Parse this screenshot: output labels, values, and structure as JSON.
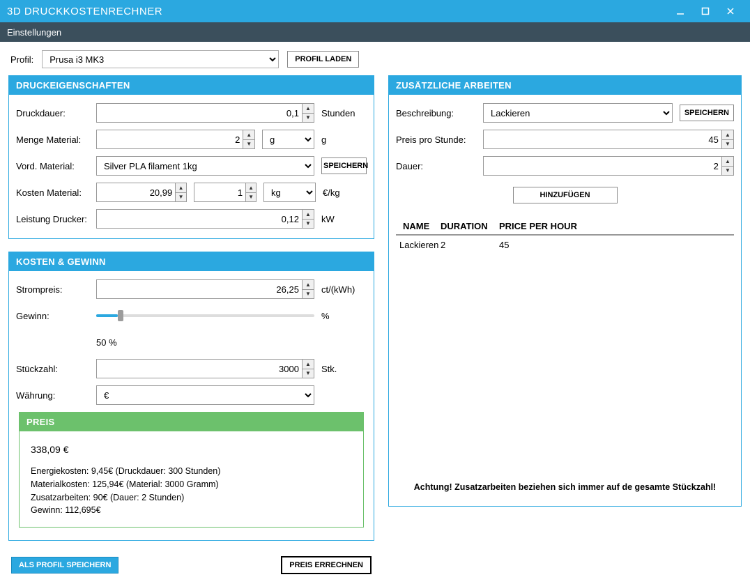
{
  "window": {
    "title": "3D DRUCKKOSTENRECHNER"
  },
  "menu": {
    "settings": "Einstellungen"
  },
  "profile": {
    "label": "Profil:",
    "selected": "Prusa i3 MK3",
    "load_btn": "PROFIL LADEN"
  },
  "props": {
    "header": "DRUCKEIGENSCHAFTEN",
    "duration_label": "Druckdauer:",
    "duration_value": "0,1",
    "duration_unit": "Stunden",
    "amount_label": "Menge Material:",
    "amount_value": "2",
    "amount_unit_sel": "g",
    "amount_unit": "g",
    "material_label": "Vord. Material:",
    "material_sel": "Silver PLA filament 1kg",
    "material_save": "SPEICHERN",
    "cost_label": "Kosten Material:",
    "cost_value": "20,99",
    "cost_qty": "1",
    "cost_unit_sel": "kg",
    "cost_unit": "€/kg",
    "power_label": "Leistung Drucker:",
    "power_value": "0,12",
    "power_unit": "kW"
  },
  "costs": {
    "header": "KOSTEN & GEWINN",
    "elec_label": "Strompreis:",
    "elec_value": "26,25",
    "elec_unit": "ct/(kWh)",
    "profit_label": "Gewinn:",
    "profit_unit": "%",
    "profit_display": "50 %",
    "qty_label": "Stückzahl:",
    "qty_value": "3000",
    "qty_unit": "Stk.",
    "currency_label": "Währung:",
    "currency_sel": "€"
  },
  "price": {
    "header": "PREIS",
    "total": "338,09 €",
    "line1": "Energiekosten: 9,45€ (Druckdauer: 300 Stunden)",
    "line2": "Materialkosten: 125,94€ (Material: 3000 Gramm)",
    "line3": "Zusatzarbeiten: 90€ (Dauer: 2 Stunden)",
    "line4": "Gewinn: 112,695€"
  },
  "bottom": {
    "save_profile": "ALS PROFIL SPEICHERN",
    "calc": "PREIS ERRECHNEN"
  },
  "extra": {
    "header": "ZUSÄTZLICHE ARBEITEN",
    "desc_label": "Beschreibung:",
    "desc_sel": "Lackieren",
    "save_btn": "SPEICHERN",
    "price_label": "Preis pro Stunde:",
    "price_value": "45",
    "dur_label": "Dauer:",
    "dur_value": "2",
    "add_btn": "HINZUFÜGEN",
    "th_name": "NAME",
    "th_dur": "DURATION",
    "th_price": "PRICE PER HOUR",
    "rows": [
      {
        "name": "Lackieren",
        "duration": "2",
        "price": "45"
      }
    ],
    "warning": "Achtung! Zusatzarbeiten beziehen sich immer auf de gesamte Stückzahl!"
  }
}
